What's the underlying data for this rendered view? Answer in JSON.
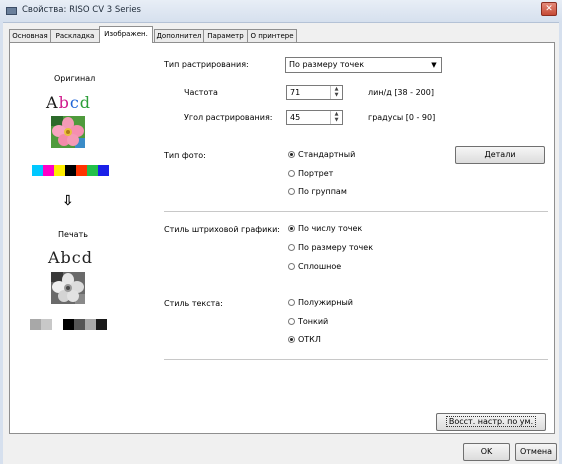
{
  "window": {
    "title": "Свойства: RISO CV 3 Series",
    "close_label": "✕"
  },
  "tabs": [
    {
      "label": "Основная"
    },
    {
      "label": "Раскладка"
    },
    {
      "label": "Изображен."
    },
    {
      "label": "Дополнител"
    },
    {
      "label": "Параметр"
    },
    {
      "label": "О принтере"
    }
  ],
  "active_tab": "Изображен.",
  "preview": {
    "original_label": "Оригинал",
    "sample_text": "Abcd",
    "arrow": "⇩",
    "print_label": "Печать",
    "original_colors": [
      "#00c8ff",
      "#ff00c8",
      "#ffee00",
      "#000000",
      "#ff3300",
      "#22c04a",
      "#1a20e8"
    ],
    "print_colors": [
      "#a8a8a8",
      "#c8c8c8",
      "#ffffff",
      "#000000",
      "#555555",
      "#aaaaaa",
      "#1a1a1a"
    ]
  },
  "screening": {
    "type_label": "Тип растрирования:",
    "type_value": "По размеру точек",
    "frequency_label": "Частота",
    "frequency_value": "71",
    "frequency_range": "лин/д [38 - 200]",
    "angle_label": "Угол растрирования:",
    "angle_value": "45",
    "angle_range": "градусы [0 - 90]"
  },
  "photo": {
    "label": "Тип фото:",
    "options": [
      "Стандартный",
      "Портрет",
      "По группам"
    ],
    "selected": "Стандартный",
    "details_button": "Детали"
  },
  "line_art": {
    "label": "Стиль штриховой графики:",
    "options": [
      "По числу точек",
      "По размеру точек",
      "Сплошное"
    ],
    "selected": "По числу точек"
  },
  "text_style": {
    "label": "Стиль текста:",
    "options": [
      "Полужирный",
      "Тонкий",
      "ОТКЛ"
    ],
    "selected": "ОТКЛ"
  },
  "buttons": {
    "restore": "Восст. настр. по ум.",
    "ok": "OK",
    "cancel": "Отмена"
  }
}
